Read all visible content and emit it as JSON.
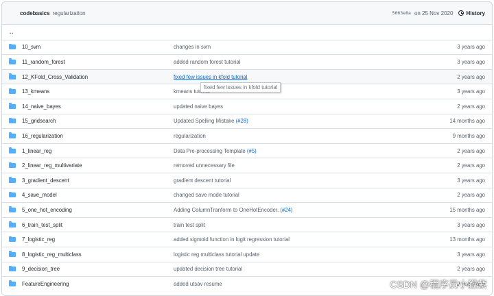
{
  "header": {
    "author": "codebasics",
    "message": "regularization",
    "sha": "5663e8a",
    "date": "on 25 Nov 2020",
    "history_label": "History"
  },
  "parent_dir": "..",
  "rows": [
    {
      "name": "10_svm",
      "message": "changes in svm",
      "age": "3 years ago"
    },
    {
      "name": "11_random_forest",
      "message": "added random forest tutorial",
      "age": "3 years ago"
    },
    {
      "name": "12_KFold_Cross_Validation",
      "message": "fixed few issues in kfold tutorial",
      "age": "2 years ago"
    },
    {
      "name": "13_kmeans",
      "message": "kmeans tutorial",
      "age": "3 years ago"
    },
    {
      "name": "14_naive_bayes",
      "message": "updated naive bayes",
      "age": "2 years ago"
    },
    {
      "name": "15_gridsearch",
      "message": "Updated Spelling Mistake",
      "pr": "(#28)",
      "age": "14 months ago"
    },
    {
      "name": "16_regularization",
      "message": "regularization",
      "age": "9 months ago"
    },
    {
      "name": "1_linear_reg",
      "message": "Data Pre-processing Template",
      "pr": "(#5)",
      "age": "2 years ago"
    },
    {
      "name": "2_linear_reg_multivariate",
      "message": "removed unnecessary file",
      "age": "2 years ago"
    },
    {
      "name": "3_gradient_descent",
      "message": "gradient descent tutorial",
      "age": "3 years ago"
    },
    {
      "name": "4_save_model",
      "message": "changed save mode tutorial",
      "age": "2 years ago"
    },
    {
      "name": "5_one_hot_encoding",
      "message": "Adding ColumnTranform to OneHotEncoder.",
      "pr": "(#24)",
      "age": "15 months ago"
    },
    {
      "name": "6_train_test_split",
      "message": "train test split",
      "age": "3 years ago"
    },
    {
      "name": "7_logistic_reg",
      "message": "added sigmoid function in logit regression tutorial",
      "age": "13 months ago"
    },
    {
      "name": "8_logistic_reg_multiclass",
      "message": "logistic reg multiclass tutorial update",
      "age": "3 years ago"
    },
    {
      "name": "9_decision_tree",
      "message": "updated decision tree tutorial",
      "age": "2 years ago"
    },
    {
      "name": "FeatureEngineering",
      "message": "added utsav resume",
      "age": "2 years ago"
    }
  ],
  "tooltip": "fixed few issues in kfold tutorial",
  "watermark": "CSDN @程序员小猴紫",
  "colors": {
    "folder": "#54aeff",
    "link": "#0969da",
    "border": "#d0d7de"
  }
}
